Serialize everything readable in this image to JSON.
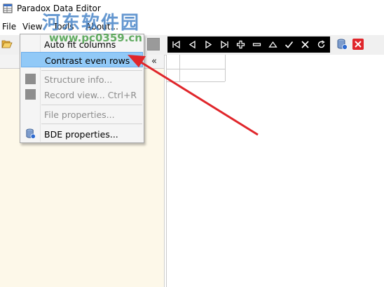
{
  "window": {
    "title": "Paradox Data Editor"
  },
  "menubar": [
    "File",
    "View",
    "Tools",
    "About..."
  ],
  "dropdown": {
    "items": [
      {
        "label": "Auto fit columns",
        "disabled": false,
        "icon": ""
      },
      {
        "label": "Contrast even rows",
        "disabled": false,
        "icon": "",
        "highlighted": true
      },
      {
        "label": "Structure info...",
        "disabled": true,
        "icon": "structure-icon"
      },
      {
        "label": "Record view...",
        "shortcut": "Ctrl+R",
        "disabled": true,
        "icon": "record-view-icon"
      },
      {
        "label": "File properties...",
        "disabled": true,
        "icon": ""
      },
      {
        "label": "BDE properties...",
        "disabled": false,
        "icon": "bde-icon"
      }
    ]
  },
  "toolbar": {
    "nav_buttons": [
      "first-icon",
      "prior-icon",
      "next-icon",
      "last-icon",
      "insert-icon",
      "delete-icon",
      "edit-icon",
      "post-icon",
      "cancel-icon",
      "refresh-icon"
    ]
  },
  "left_panel": {
    "collapse_glyph": "«"
  },
  "watermark": {
    "text": "河东软件园",
    "url": "www.pc0359.cn"
  },
  "colors": {
    "highlight": "#91c9f7",
    "left_panel": "#fdf8e9",
    "arrow": "#e0262b",
    "navbar": "#000000"
  }
}
